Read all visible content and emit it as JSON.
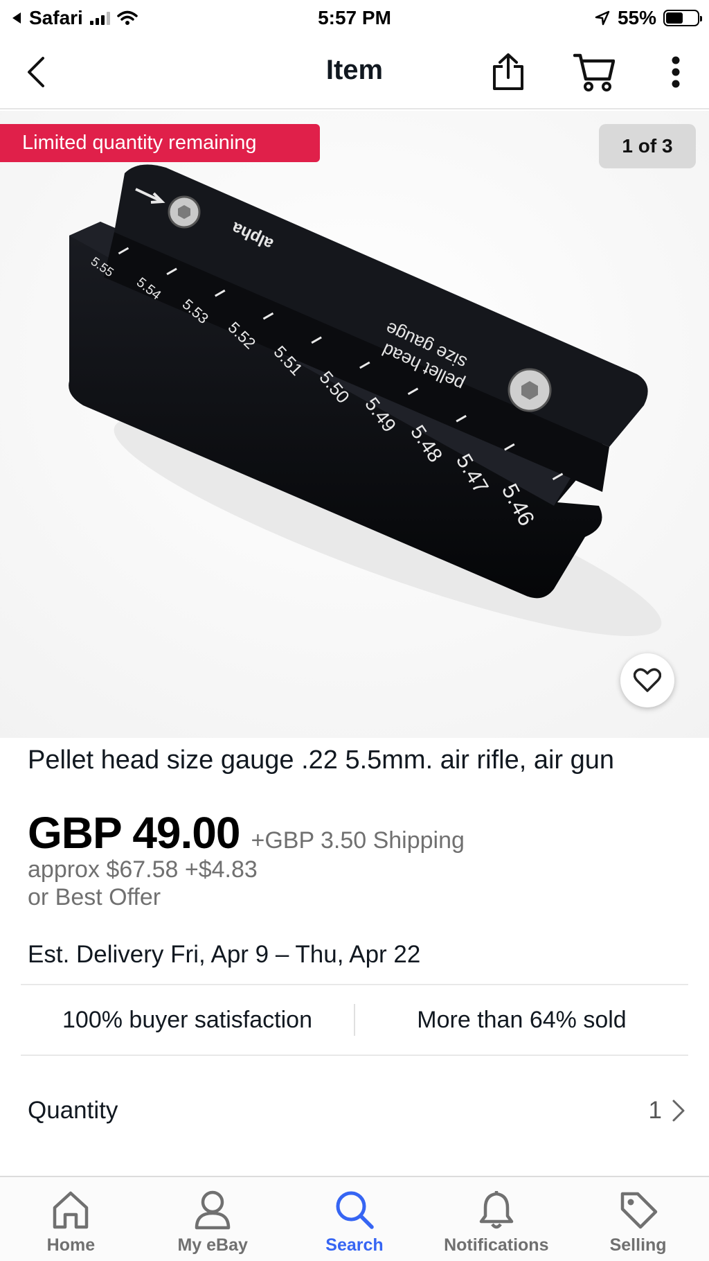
{
  "status_bar": {
    "back_app": "Safari",
    "time": "5:57 PM",
    "battery": "55%",
    "battery_level": 0.55
  },
  "nav": {
    "title": "Item",
    "icons": [
      "chevron-left-icon",
      "share-icon",
      "cart-icon",
      "more-vertical-icon"
    ]
  },
  "hero": {
    "limited_badge": "Limited quantity remaining",
    "image_counter": "1 of 3",
    "image_text": {
      "plate_line1": "pellet head",
      "plate_line2": "size gauge",
      "logo": "alpha",
      "scale_marks": [
        "5.55",
        "5.54",
        "5.53",
        "5.52",
        "5.51",
        "5.50",
        "5.49",
        "5.48",
        "5.47",
        "5.46"
      ]
    },
    "colors": {
      "badge": "#e0204a"
    }
  },
  "item": {
    "title": "Pellet head size gauge .22 5.5mm.  air rifle, air gun",
    "price": "GBP 49.00",
    "shipping": "+GBP 3.50 Shipping",
    "approx": "approx $67.58 +$4.83",
    "best_offer": "or Best Offer",
    "delivery": "Est. Delivery Fri, Apr 9 – Thu, Apr 22"
  },
  "stats": {
    "satisfaction": "100% buyer satisfaction",
    "sold": "More than 64% sold"
  },
  "quantity": {
    "label": "Quantity",
    "value": "1"
  },
  "tab_bar": {
    "active": "Search",
    "active_color": "#3665f3",
    "tabs": [
      {
        "label": "Home",
        "icon": "home-icon"
      },
      {
        "label": "My eBay",
        "icon": "person-icon"
      },
      {
        "label": "Search",
        "icon": "search-icon"
      },
      {
        "label": "Notifications",
        "icon": "bell-icon"
      },
      {
        "label": "Selling",
        "icon": "tag-icon"
      }
    ]
  }
}
